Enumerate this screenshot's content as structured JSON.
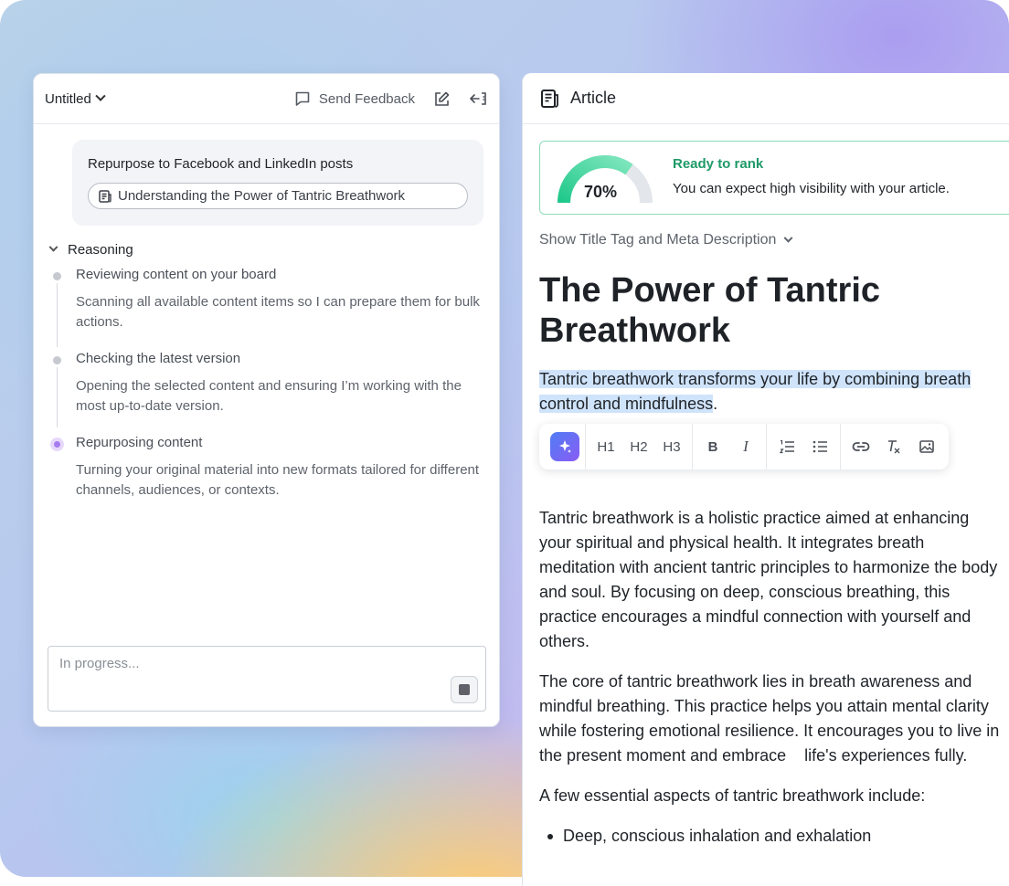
{
  "left_panel": {
    "doc_title": "Untitled",
    "feedback_label": "Send Feedback",
    "request": {
      "text": "Repurpose to Facebook and LinkedIn posts",
      "chip_label": "Understanding the Power of Tantric Breathwork"
    },
    "reasoning_label": "Reasoning",
    "steps": [
      {
        "title": "Reviewing content on your board",
        "desc": "Scanning all available content items so I can prepare them for bulk actions."
      },
      {
        "title": "Checking the latest version",
        "desc": "Opening the selected content and ensuring I’m working with the most up-to-date version."
      },
      {
        "title": "Repurposing content",
        "desc": "Turning your original material into new formats tailored for different channels, audiences, or contexts."
      }
    ],
    "input_placeholder": "In progress..."
  },
  "right_panel": {
    "header_title": "Article",
    "rank": {
      "score": 70,
      "score_label": "70%",
      "title": "Ready to rank",
      "desc": "You can expect high visibility with your article.",
      "accent_color": "#1e9a67"
    },
    "meta_toggle": "Show Title Tag and Meta Description",
    "article_title": "The Power of Tantric Breathwork",
    "intro_highlight": "Tantric breathwork transforms your life by combining breath control and mindfulness",
    "intro_tail": ".",
    "toolbar": {
      "h1": "H1",
      "h2": "H2",
      "h3": "H3",
      "bold": "B",
      "italic": "I"
    },
    "paragraphs": [
      "Tantric breathwork is a holistic practice aimed at enhancing    your spiritual and physical health. It integrates breath meditation with ancient tantric principles to harmonize the body and soul. By focusing on deep, conscious breathing, this practice encourages a mindful connection with yourself and others.",
      "The core of tantric breathwork lies in breath awareness and   mindful breathing. This practice helps you attain mental clarity while fostering emotional resilience. It encourages you to live in the present moment and embrace    life's experiences fully.",
      "A few essential aspects of tantric breathwork include:"
    ],
    "bullets": [
      "Deep, conscious inhalation and exhalation"
    ]
  }
}
